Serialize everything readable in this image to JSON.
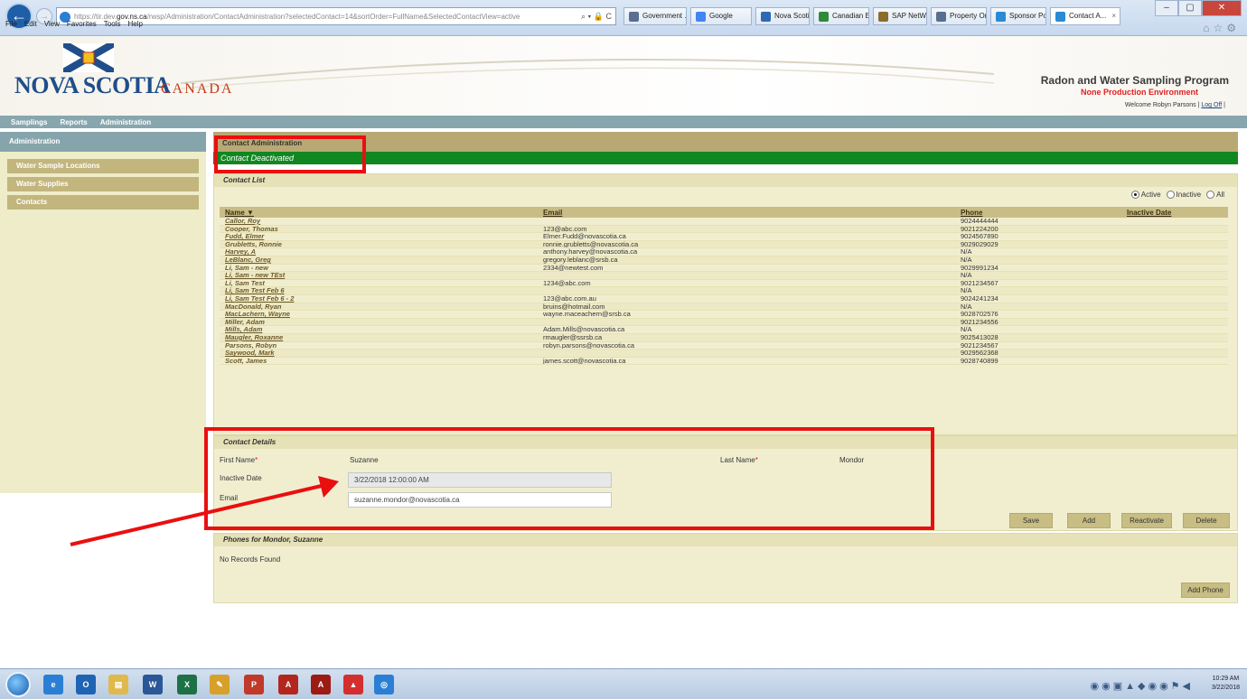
{
  "browser": {
    "url_prefix": "https://tir.dev.",
    "url_domain": "gov.ns.ca",
    "url_path": "/rwsp/Administration/ContactAdministration?selectedContact=14&sortOrder=FullName&SelectedContactView=active",
    "url_controls": "⌕ ▾ 🔒 C",
    "tabs": [
      {
        "label": "Government ...",
        "color": "#5a6f8f"
      },
      {
        "label": "Google",
        "color": "#4285f4"
      },
      {
        "label": "Nova Scotia ...",
        "color": "#2d6ab3"
      },
      {
        "label": "Canadian En...",
        "color": "#2f8a3a"
      },
      {
        "label": "SAP NetWea...",
        "color": "#8a6d2a"
      },
      {
        "label": "Property Onl...",
        "color": "#5a6f8f"
      },
      {
        "label": "Sponsor Port...",
        "color": "#2a8ad4"
      },
      {
        "label": "Contact A...",
        "color": "#2a8ad4"
      }
    ],
    "menu": [
      "File",
      "Edit",
      "View",
      "Favorites",
      "Tools",
      "Help"
    ]
  },
  "banner": {
    "logo_text": "NOVA SCOTIA",
    "logo_canada": "CANADA",
    "program_title": "Radon and Water Sampling Program",
    "environment": "None Production Environment",
    "welcome_prefix": "Welcome Robyn Parsons | ",
    "logoff": "Log Off",
    "welcome_suffix": " |"
  },
  "topnav": [
    "Samplings",
    "Reports",
    "Administration"
  ],
  "sidebar": {
    "header": "Administration",
    "items": [
      "Water Sample Locations",
      "Water Supplies",
      "Contacts"
    ]
  },
  "main": {
    "section_title": "Contact Administration",
    "notice": "Contact Deactivated"
  },
  "contact_list": {
    "title": "Contact List",
    "filter_options": [
      "Active",
      "Inactive",
      "All"
    ],
    "selected_filter": "Active",
    "columns": [
      "Name ▼",
      "Email",
      "Phone",
      "Inactive Date"
    ],
    "rows": [
      {
        "name": "Callor, Roy",
        "email": "",
        "phone": "9024444444",
        "inactive": ""
      },
      {
        "name": "Cooper, Thomas",
        "email": "123@abc.com",
        "phone": "9021224200",
        "inactive": ""
      },
      {
        "name": "Fudd, Elmer",
        "email": "Elmer.Fudd@novascotia.ca",
        "phone": "9024567890",
        "inactive": ""
      },
      {
        "name": "Grubletts, Ronnie",
        "email": "ronnie.grubletts@novascotia.ca",
        "phone": "9029029029",
        "inactive": ""
      },
      {
        "name": "Harvey, A",
        "email": "anthony.harvey@novascotia.ca",
        "phone": "N/A",
        "inactive": ""
      },
      {
        "name": "LeBlanc, Greg",
        "email": "gregory.leblanc@srsb.ca",
        "phone": "N/A",
        "inactive": ""
      },
      {
        "name": "Li, Sam - new",
        "email": "2334@newtest.com",
        "phone": "9029991234",
        "inactive": ""
      },
      {
        "name": "Li, Sam - new TEst",
        "email": "",
        "phone": "N/A",
        "inactive": ""
      },
      {
        "name": "Li, Sam Test",
        "email": "1234@abc.com",
        "phone": "9021234567",
        "inactive": ""
      },
      {
        "name": "Li, Sam Test Feb 6",
        "email": "",
        "phone": "N/A",
        "inactive": ""
      },
      {
        "name": "Li, Sam Test Feb 6 - 2",
        "email": "123@abc.com.au",
        "phone": "9024241234",
        "inactive": ""
      },
      {
        "name": "MacDonald, Ryan",
        "email": "bruins@hotmail.com",
        "phone": "N/A",
        "inactive": ""
      },
      {
        "name": "MacLachern, Wayne",
        "email": "wayne.maceachern@srsb.ca",
        "phone": "9028702576",
        "inactive": ""
      },
      {
        "name": "Miller, Adam",
        "email": "",
        "phone": "9021234556",
        "inactive": ""
      },
      {
        "name": "Mills, Adam",
        "email": "Adam.Mills@novascotia.ca",
        "phone": "N/A",
        "inactive": ""
      },
      {
        "name": "Maugler, Roxanne",
        "email": "rmaugler@ssrsb.ca",
        "phone": "9025413028",
        "inactive": ""
      },
      {
        "name": "Parsons, Robyn",
        "email": "robyn.parsons@novascotia.ca",
        "phone": "9021234567",
        "inactive": ""
      },
      {
        "name": "Saywood, Mark",
        "email": "",
        "phone": "9029562368",
        "inactive": ""
      },
      {
        "name": "Scott, James",
        "email": "james.scott@novascotia.ca",
        "phone": "9028740899",
        "inactive": ""
      }
    ]
  },
  "contact_details": {
    "title": "Contact Details",
    "first_name_label": "First Name",
    "first_name": "Suzanne",
    "last_name_label": "Last Name",
    "last_name": "Mondor",
    "inactive_date_label": "Inactive Date",
    "inactive_date": "3/22/2018 12:00:00 AM",
    "email_label": "Email",
    "email": "suzanne.mondor@novascotia.ca",
    "required_mark": "*",
    "buttons": [
      "Save",
      "Add",
      "Reactivate",
      "Delete"
    ]
  },
  "phones": {
    "title": "Phones for Mondor, Suzanne",
    "empty_text": "No Records Found",
    "add_button": "Add Phone"
  },
  "taskbar": {
    "clock_time": "10:29 AM",
    "clock_date": "3/22/2018",
    "apps": [
      {
        "name": "ie",
        "label": "e",
        "color": "#2a7fd4"
      },
      {
        "name": "outlook",
        "label": "O",
        "color": "#1f64b3"
      },
      {
        "name": "explorer",
        "label": "▤",
        "color": "#e0b94a"
      },
      {
        "name": "word",
        "label": "W",
        "color": "#2b5797"
      },
      {
        "name": "excel",
        "label": "X",
        "color": "#1e7145"
      },
      {
        "name": "paint",
        "label": "✎",
        "color": "#d6a02a"
      },
      {
        "name": "powerpoint",
        "label": "P",
        "color": "#c0392b"
      },
      {
        "name": "acrobat",
        "label": "A",
        "color": "#b3261e"
      },
      {
        "name": "acrobat-reader",
        "label": "A",
        "color": "#9c1b15"
      },
      {
        "name": "adobe",
        "label": "▲",
        "color": "#d32f2f"
      },
      {
        "name": "sync",
        "label": "◎",
        "color": "#2a7fd4"
      }
    ]
  },
  "colors": {
    "notice_green": "#118722",
    "annotation_red": "#ea0f0f",
    "nav_teal": "#88a6ad",
    "tan": "#c2b57d"
  }
}
